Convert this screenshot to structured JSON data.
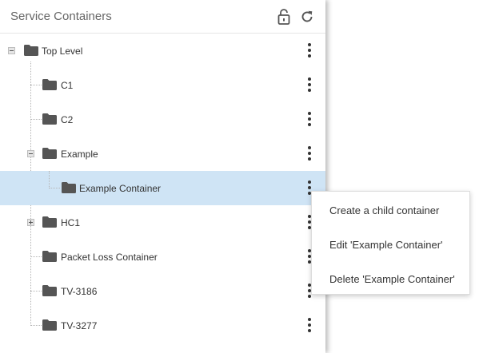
{
  "panel": {
    "title": "Service Containers",
    "lock_icon": "lock-open-icon",
    "refresh_icon": "refresh-icon"
  },
  "tree": {
    "nodes": [
      {
        "label": "Top Level",
        "toggle": "minus",
        "selected": false
      },
      {
        "label": "C1",
        "toggle": null,
        "selected": false
      },
      {
        "label": "C2",
        "toggle": null,
        "selected": false
      },
      {
        "label": "Example",
        "toggle": "minus",
        "selected": false
      },
      {
        "label": "Example Container",
        "toggle": null,
        "selected": true
      },
      {
        "label": "HC1",
        "toggle": "plus",
        "selected": false
      },
      {
        "label": "Packet Loss Container",
        "toggle": null,
        "selected": false
      },
      {
        "label": "TV-3186",
        "toggle": null,
        "selected": false
      },
      {
        "label": "TV-3277",
        "toggle": null,
        "selected": false
      }
    ]
  },
  "context_menu": {
    "items": [
      "Create a child container",
      "Edit 'Example Container'",
      "Delete 'Example Container'"
    ]
  },
  "colors": {
    "selected_row": "#cfe4f5",
    "folder": "#555555"
  }
}
